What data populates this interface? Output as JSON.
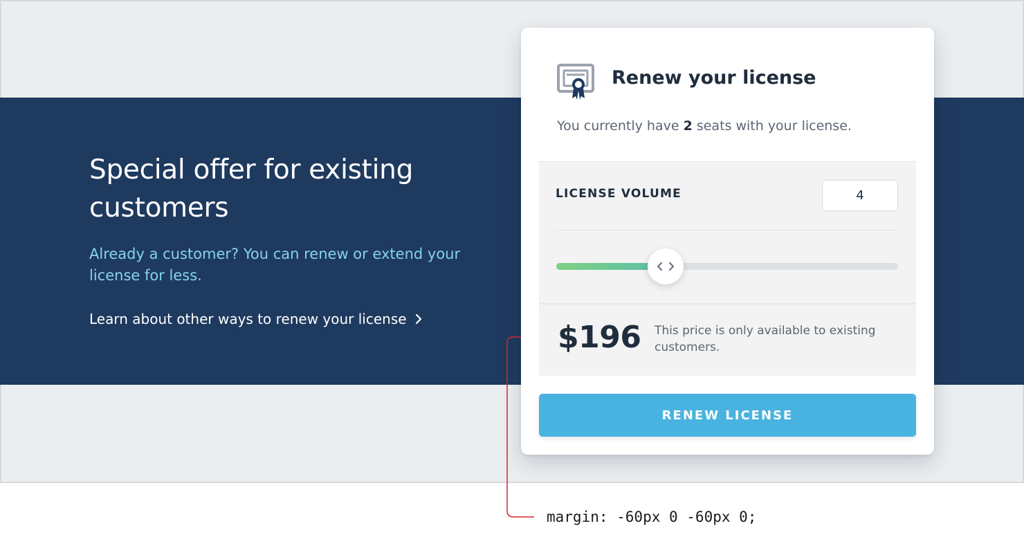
{
  "hero": {
    "title": "Special offer for existing customers",
    "subtitle": "Already a customer? You can renew or extend your license for less.",
    "link_label": "Learn about other ways to renew your license"
  },
  "card": {
    "icon": "certificate-icon",
    "title": "Renew your license",
    "seats_prefix": "You currently have",
    "seats_count": "2",
    "seats_suffix": "seats with your license.",
    "volume_label": "LICENSE VOLUME",
    "volume_value": "4",
    "slider_fraction": 0.32,
    "price": "$196",
    "price_note": "This price is only available to existing customers.",
    "button_label": "RENEW LICENSE"
  },
  "annotation": {
    "code": "margin: -60px 0 -60px 0;"
  },
  "colors": {
    "band": "#1f3a5f",
    "accent_text": "#86d3ea",
    "button": "#48b3e0",
    "slider_fill_start": "#7fd183",
    "slider_fill_end": "#5bbfa8",
    "annotation_line": "#d0262d"
  }
}
